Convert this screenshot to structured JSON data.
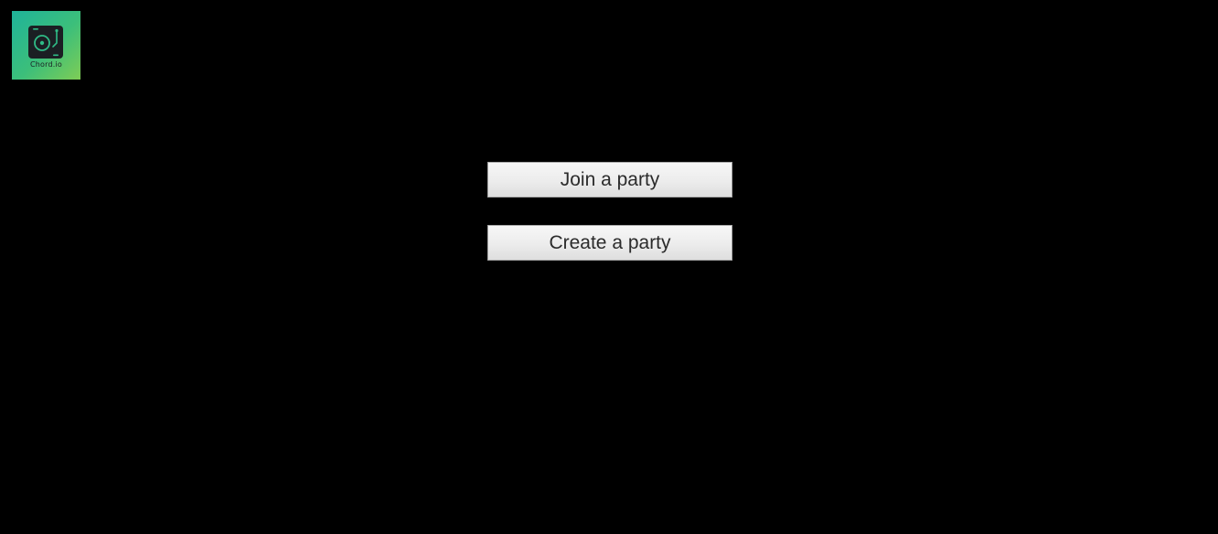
{
  "logo": {
    "text": "Chord.io",
    "icon": "turntable-icon",
    "colors": {
      "gradient_start": "#1fb39a",
      "gradient_end": "#7fcd55",
      "icon": "#1b1f23"
    }
  },
  "actions": {
    "join_label": "Join a party",
    "create_label": "Create a party"
  },
  "colors": {
    "background": "#000000",
    "button_text": "#2b2b2b"
  }
}
